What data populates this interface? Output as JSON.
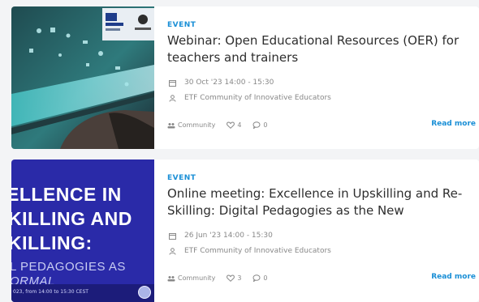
{
  "events": [
    {
      "tag": "EVENT",
      "title": "Webinar: Open Educational Resources (OER) for teachers and trainers",
      "date": "30 Oct '23 14:00 - 15:30",
      "organiser": "ETF Community of Innovative Educators",
      "category": "Community",
      "likes": "4",
      "comments": "0",
      "read_more": "Read more"
    },
    {
      "tag": "EVENT",
      "title": "Online meeting: Excellence in Upskilling and Re-Skilling: Digital Pedagogies as the New",
      "date": "26 Jun '23 14:00 - 15:30",
      "organiser": "ETF Community of Innovative Educators",
      "category": "Community",
      "likes": "3",
      "comments": "0",
      "read_more": "Read more",
      "thumb_lines": [
        "ELLENCE IN",
        "KILLING AND",
        "KILLING:",
        "L PEDAGOGIES AS",
        "ORMAL"
      ],
      "thumb_footer": "023, from 14:00 to 15:30 CEST"
    }
  ],
  "colors": {
    "accent": "#1a8fd6",
    "meta": "#888888",
    "title": "#2e2e2e",
    "thumb2_bg": "#2a2aa8"
  }
}
